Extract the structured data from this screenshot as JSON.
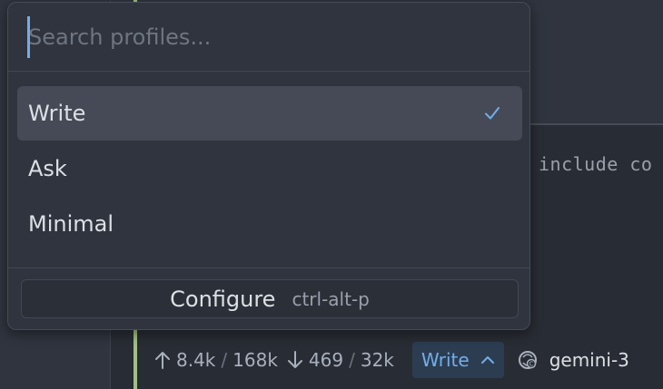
{
  "editor": {
    "code_fragment": "include co"
  },
  "popover": {
    "search": {
      "placeholder": "Search profiles...",
      "value": ""
    },
    "profiles": [
      {
        "label": "Write",
        "selected": true
      },
      {
        "label": "Ask",
        "selected": false
      },
      {
        "label": "Minimal",
        "selected": false
      }
    ],
    "configure": {
      "label": "Configure",
      "shortcut": "ctrl-alt-p"
    }
  },
  "statusbar": {
    "input_tokens": "8.4k",
    "input_limit": "168k",
    "output_tokens": "469",
    "output_limit": "32k",
    "separator": "/",
    "profile_button_label": "Write",
    "model_label": "gemini-3"
  },
  "colors": {
    "accent": "#74ade8",
    "gutter_added": "#a1c181",
    "popover_bg": "#2f343e",
    "selected_bg": "#454a56"
  }
}
